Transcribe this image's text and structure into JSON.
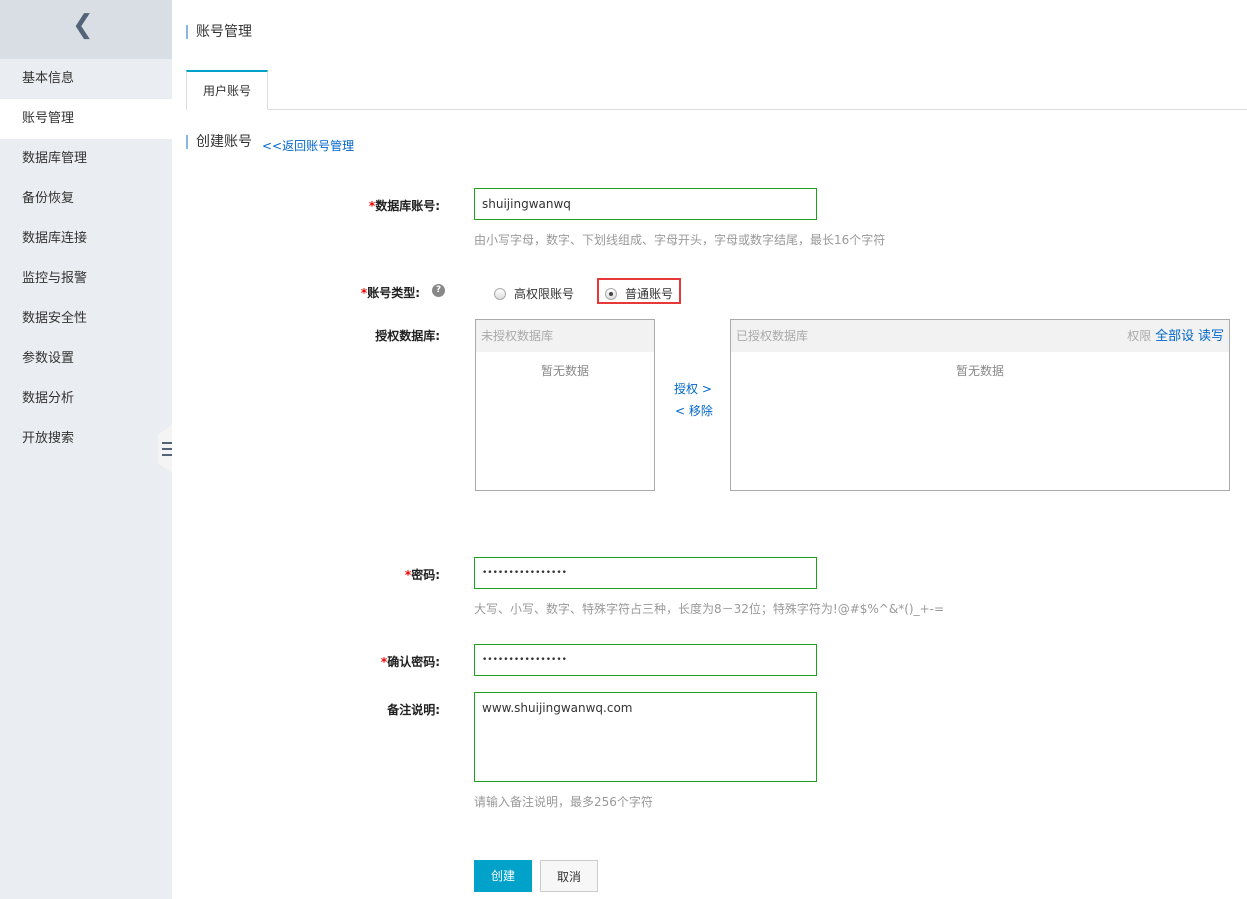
{
  "sidebar": {
    "items": [
      "基本信息",
      "账号管理",
      "数据库管理",
      "备份恢复",
      "数据库连接",
      "监控与报警",
      "数据安全性",
      "参数设置",
      "数据分析",
      "开放搜索"
    ],
    "active": 1
  },
  "page_title": "账号管理",
  "tab": "用户账号",
  "section_title": "创建账号",
  "back_link": "<<返回账号管理",
  "form": {
    "db_account": {
      "label": "数据库账号:",
      "value": "shuijingwanwq",
      "hint": "由小写字母，数字、下划线组成、字母开头，字母或数字结尾，最长16个字符"
    },
    "account_type": {
      "label": "账号类型:",
      "options": [
        "高权限账号",
        "普通账号"
      ],
      "selected": "普通账号"
    },
    "authorize": {
      "label": "授权数据库:",
      "left_title": "未授权数据库",
      "right_title": "已授权数据库",
      "empty": "暂无数据",
      "perm_label": "权限",
      "set_all": "全部设",
      "read_write": "读写",
      "grant": "授权 >",
      "remove": "< 移除"
    },
    "password": {
      "label": "密码:",
      "value": "••••••••••••••••",
      "hint": "大写、小写、数字、特殊字符占三种，长度为8－32位；特殊字符为!@#$%^&*()_+-="
    },
    "confirm_password": {
      "label": "确认密码:",
      "value": "••••••••••••••••"
    },
    "remark": {
      "label": "备注说明:",
      "value": "www.shuijingwanwq.com",
      "hint": "请输入备注说明，最多256个字符"
    }
  },
  "buttons": {
    "create": "创建",
    "cancel": "取消"
  },
  "colors": {
    "accent": "#00a2ca",
    "primary": "#00a2ca",
    "link": "#0066cc",
    "valid_border": "#1da01d",
    "highlight": "#e63838"
  }
}
